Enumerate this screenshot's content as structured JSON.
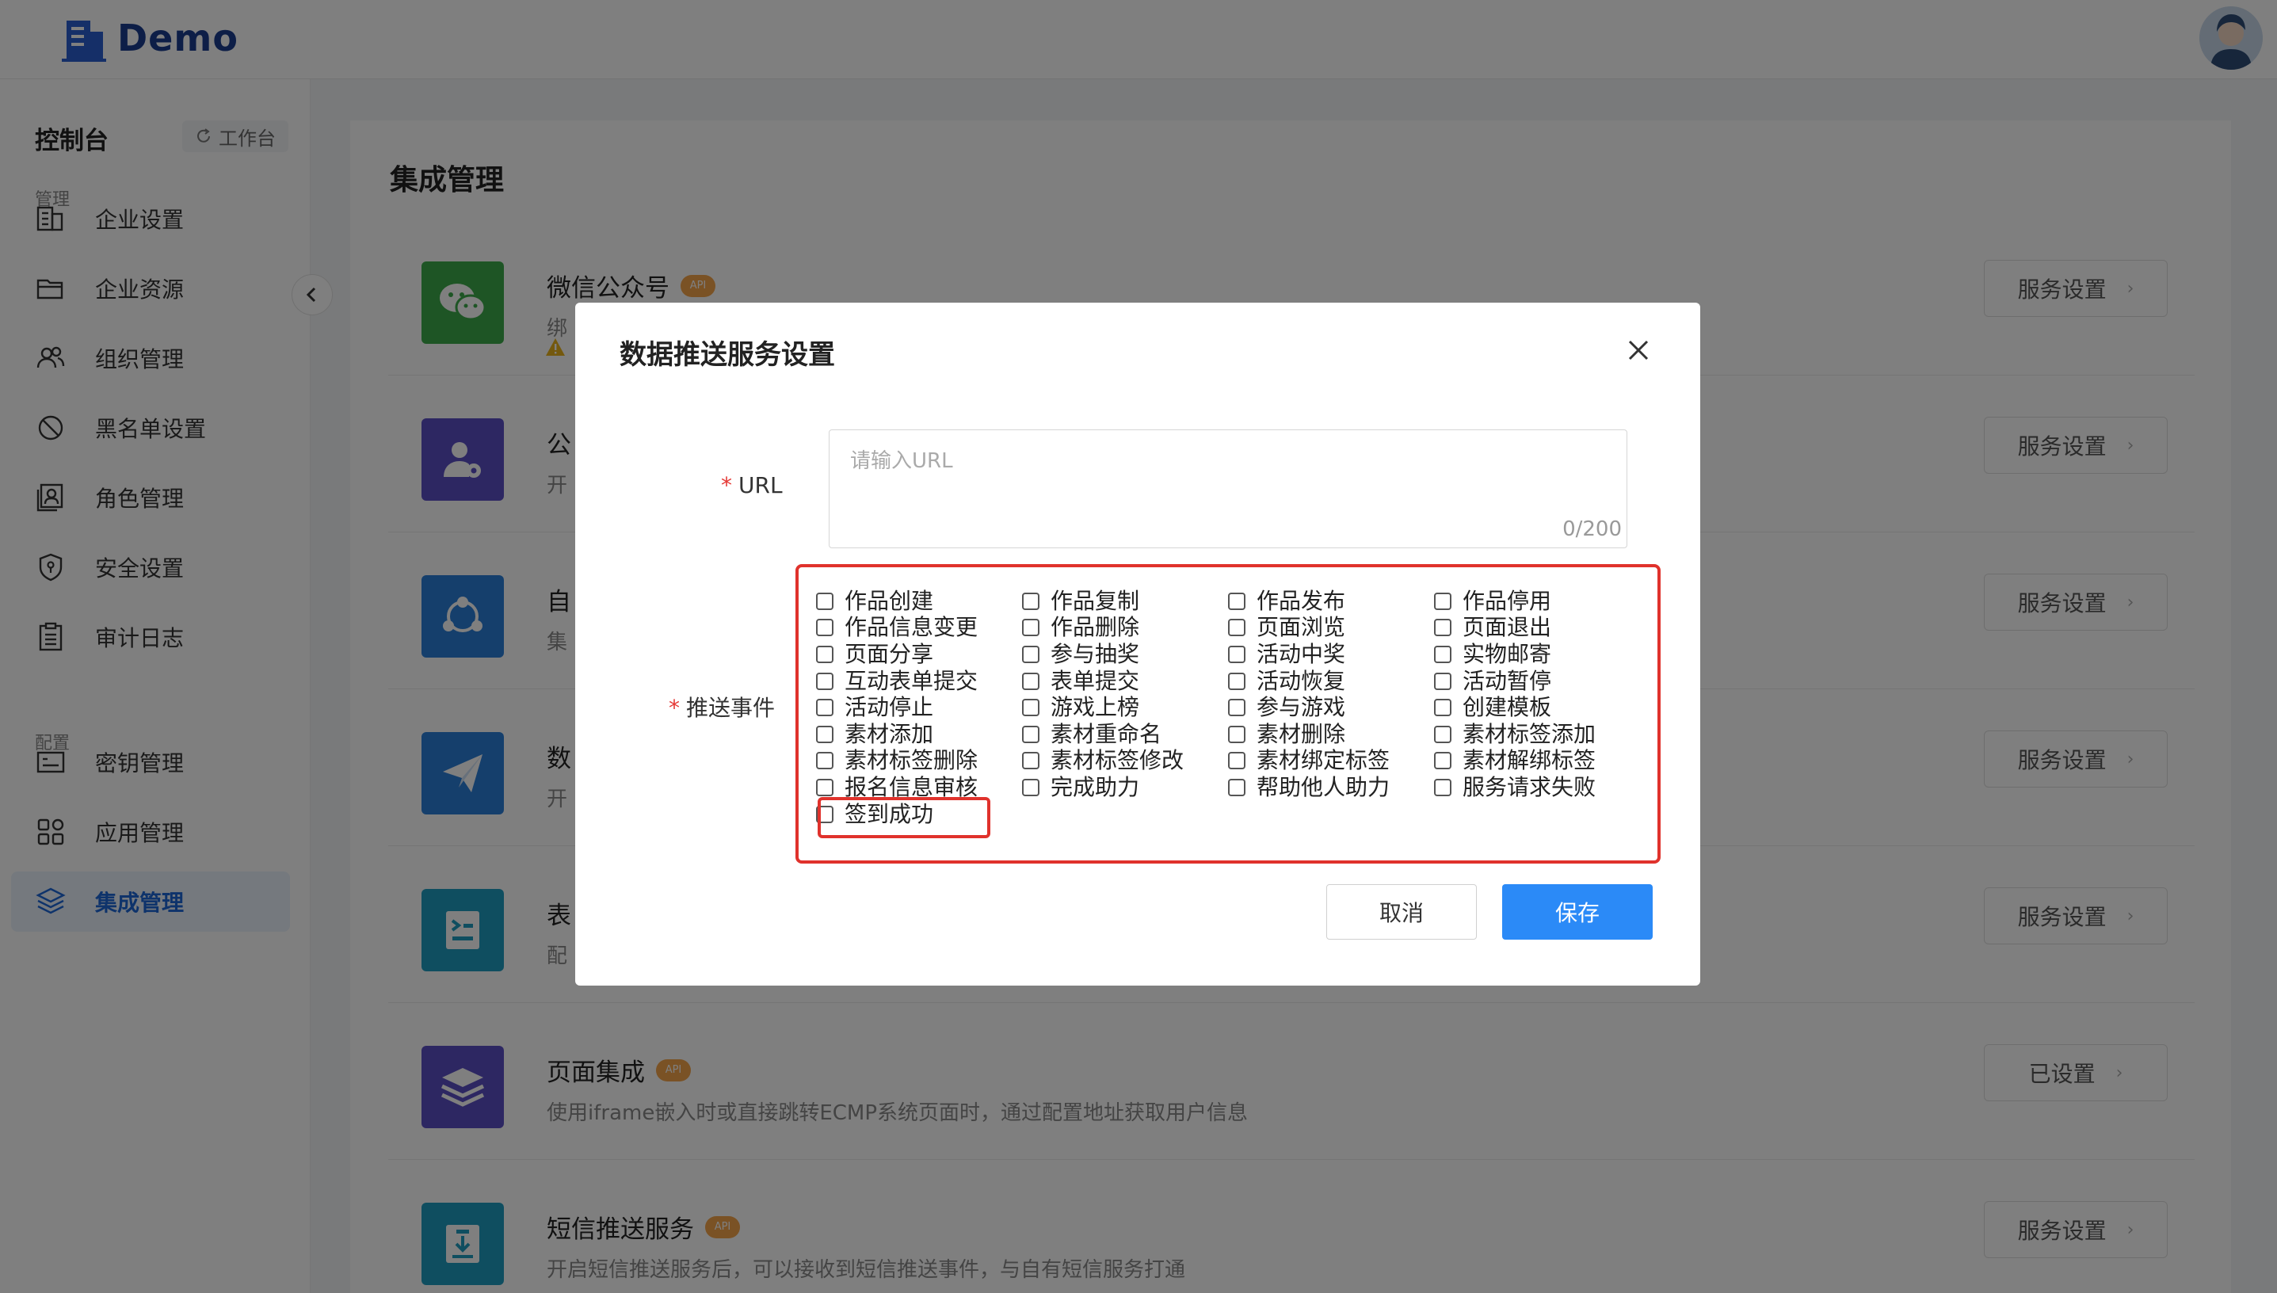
{
  "app": {
    "logo_text": "Demo"
  },
  "sidebar": {
    "title": "控制台",
    "workbench_label": "工作台",
    "groups": [
      {
        "label": "管理",
        "items": [
          {
            "label": "企业设置",
            "icon": "building-icon"
          },
          {
            "label": "企业资源",
            "icon": "folder-icon"
          },
          {
            "label": "组织管理",
            "icon": "users-icon"
          },
          {
            "label": "黑名单设置",
            "icon": "ban-icon"
          },
          {
            "label": "角色管理",
            "icon": "role-icon"
          },
          {
            "label": "安全设置",
            "icon": "shield-icon"
          },
          {
            "label": "审计日志",
            "icon": "clipboard-icon"
          }
        ]
      },
      {
        "label": "配置",
        "items": [
          {
            "label": "密钥管理",
            "icon": "key-card-icon"
          },
          {
            "label": "应用管理",
            "icon": "apps-icon"
          },
          {
            "label": "集成管理",
            "icon": "layers-icon",
            "active": true
          }
        ]
      }
    ]
  },
  "main": {
    "title": "集成管理",
    "rows": [
      {
        "title": "微信公众号",
        "api": "API",
        "desc": "绑",
        "button": "服务设置",
        "color": "#3daa4b",
        "icon": "wechat-icon"
      },
      {
        "title": "公",
        "api": "",
        "desc": "开",
        "button": "服务设置",
        "color": "#5a4fc4",
        "icon": "user-gear-icon"
      },
      {
        "title": "自",
        "api": "",
        "desc": "集",
        "button": "服务设置",
        "color": "#2a7ed8",
        "icon": "share-icon"
      },
      {
        "title": "数",
        "api": "",
        "desc": "开",
        "button": "服务设置",
        "color": "#2a7ed8",
        "icon": "paper-plane-icon"
      },
      {
        "title": "表",
        "api": "",
        "desc": "配",
        "button": "服务设置",
        "color": "#1f9dc0",
        "icon": "form-icon"
      },
      {
        "title": "页面集成",
        "api": "API",
        "desc": "使用iframe嵌入时或直接跳转ECMP系统页面时，通过配置地址获取用户信息",
        "button": "已设置",
        "color": "#5a4fc4",
        "icon": "layers-icon"
      },
      {
        "title": "短信推送服务",
        "api": "API",
        "desc": "开启短信推送服务后，可以接收到短信推送事件，与自有短信服务打通",
        "button": "服务设置",
        "color": "#1f9dc0",
        "icon": "sms-download-icon"
      }
    ]
  },
  "modal": {
    "title": "数据推送服务设置",
    "url_label": "URL",
    "url_value": "",
    "url_placeholder": "请输入URL",
    "url_counter": "0/200",
    "events_label": "推送事件",
    "events": [
      "作品创建",
      "作品复制",
      "作品发布",
      "作品停用",
      "作品信息变更",
      "作品删除",
      "页面浏览",
      "页面退出",
      "页面分享",
      "参与抽奖",
      "活动中奖",
      "实物邮寄",
      "互动表单提交",
      "表单提交",
      "活动恢复",
      "活动暂停",
      "活动停止",
      "游戏上榜",
      "参与游戏",
      "创建模板",
      "素材添加",
      "素材重命名",
      "素材删除",
      "素材标签添加",
      "素材标签删除",
      "素材标签修改",
      "素材绑定标签",
      "素材解绑标签",
      "报名信息审核",
      "完成助力",
      "帮助他人助力",
      "服务请求失败",
      "签到成功"
    ],
    "cancel_label": "取消",
    "save_label": "保存"
  },
  "colors": {
    "accent": "#2b8af7",
    "active_nav": "#1d66d6",
    "highlight": "#e0322c",
    "api_badge": "#f4a44a"
  }
}
